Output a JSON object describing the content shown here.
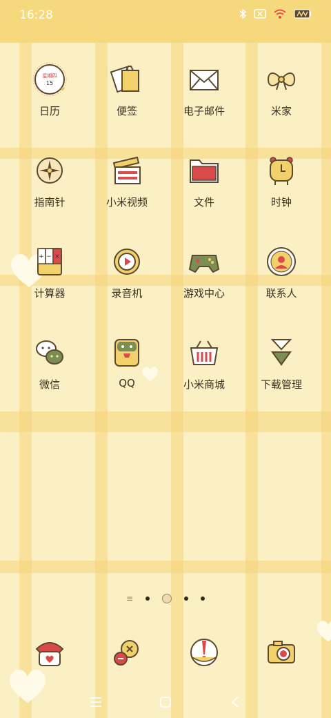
{
  "status": {
    "time": "16:28",
    "icons": [
      "bluetooth-icon",
      "sim-off-icon",
      "wifi-icon",
      "battery-icon"
    ]
  },
  "apps": [
    {
      "name": "calendar",
      "label": "日历",
      "icon": "calendar-icon",
      "calendar_text": "星期四",
      "calendar_day": "15"
    },
    {
      "name": "notes",
      "label": "便签",
      "icon": "notes-icon"
    },
    {
      "name": "email",
      "label": "电子邮件",
      "icon": "envelope-icon"
    },
    {
      "name": "mi-home",
      "label": "米家",
      "icon": "bow-icon"
    },
    {
      "name": "compass",
      "label": "指南针",
      "icon": "compass-icon"
    },
    {
      "name": "mi-video",
      "label": "小米视频",
      "icon": "clapperboard-icon"
    },
    {
      "name": "files",
      "label": "文件",
      "icon": "folder-icon"
    },
    {
      "name": "clock",
      "label": "时钟",
      "icon": "alarm-clock-icon"
    },
    {
      "name": "calculator",
      "label": "计算器",
      "icon": "calculator-icon"
    },
    {
      "name": "recorder",
      "label": "录音机",
      "icon": "play-circle-icon"
    },
    {
      "name": "game-center",
      "label": "游戏中心",
      "icon": "gamepad-icon"
    },
    {
      "name": "contacts",
      "label": "联系人",
      "icon": "person-icon"
    },
    {
      "name": "wechat",
      "label": "微信",
      "icon": "wechat-icon"
    },
    {
      "name": "qq",
      "label": "QQ",
      "icon": "qq-icon"
    },
    {
      "name": "mi-store",
      "label": "小米商城",
      "icon": "basket-icon"
    },
    {
      "name": "downloads",
      "label": "下载管理",
      "icon": "download-icon"
    }
  ],
  "dock": [
    {
      "name": "phone",
      "icon": "phone-icon"
    },
    {
      "name": "messages",
      "icon": "chat-bubble-icon"
    },
    {
      "name": "browser",
      "icon": "browser-icon"
    },
    {
      "name": "camera",
      "icon": "camera-icon"
    }
  ],
  "page_indicator": {
    "pages": 4,
    "current": 1
  }
}
